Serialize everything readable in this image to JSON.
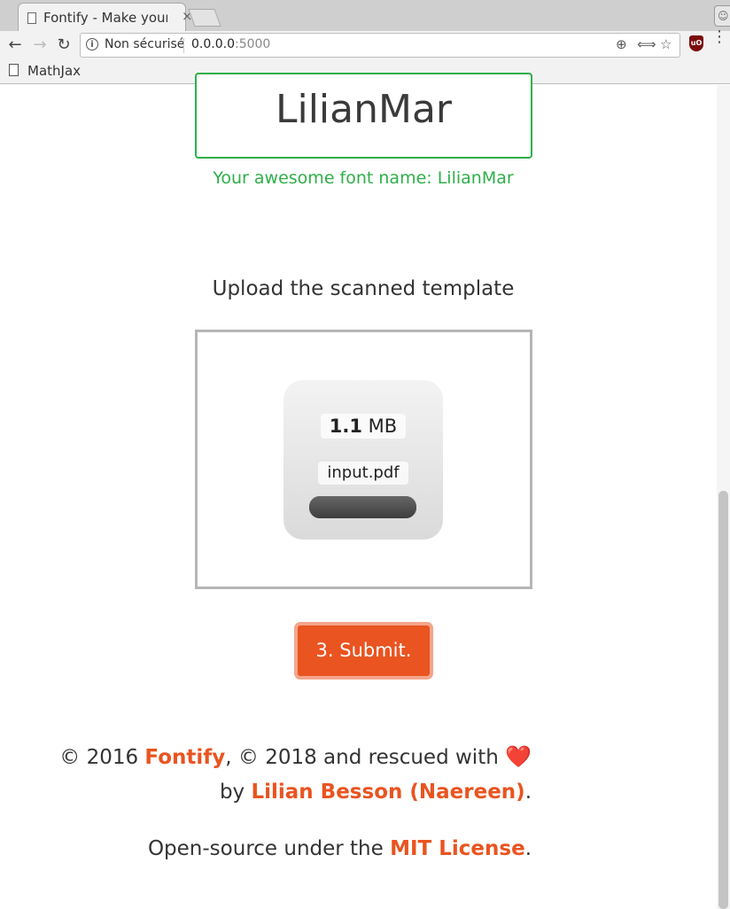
{
  "browser": {
    "tab_title": "Fontify - Make your own font with a template",
    "tab_close": "×",
    "omnibox": {
      "security_label": "Non sécurisé",
      "url_host": "0.0.0.0",
      "url_port": ":5000"
    },
    "bookmarks": [
      "MathJax"
    ],
    "icons": {
      "back": "←",
      "forward": "→",
      "reload": "↻",
      "info": "i",
      "zoom": "⊕",
      "translate": "⟺",
      "star": "☆",
      "ublock": "uO",
      "menu": "⋮",
      "profile": "☺"
    }
  },
  "page": {
    "font_name_value": "LilianMar",
    "font_name_message": "Your awesome font name: LilianMar",
    "upload_title": "Upload the scanned template",
    "file": {
      "size_number": "1.1",
      "size_unit": " MB",
      "name": "input.pdf",
      "progress": 1.0
    },
    "submit_label": "3. Submit.",
    "footer": {
      "line1_prefix": "© 2016 ",
      "fontify_link": "Fontify",
      "line1_middle": ", © 2018 and rescued with ",
      "heart": "❤️",
      "line2_prefix": "by ",
      "author_link": "Lilian Besson (Naereen)",
      "line2_suffix": ".",
      "line3_prefix": "Open-source under the ",
      "license_link": "MIT License",
      "line3_suffix": "."
    }
  },
  "colors": {
    "accent": "#e95420",
    "success": "#2eaf48"
  }
}
